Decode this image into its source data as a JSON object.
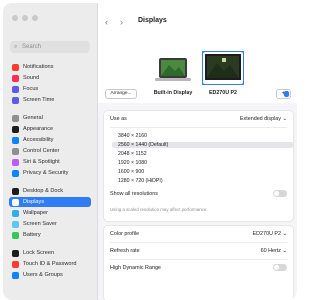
{
  "window": {
    "title": "Displays"
  },
  "sidebar": {
    "search_placeholder": "Search",
    "items": [
      {
        "label": "Notifications",
        "color": "#ff3b30",
        "icon": "bell-icon"
      },
      {
        "label": "Sound",
        "color": "#ff2d55",
        "icon": "speaker-icon"
      },
      {
        "label": "Focus",
        "color": "#5e5ce6",
        "icon": "moon-icon"
      },
      {
        "label": "Screen Time",
        "color": "#5e5ce6",
        "icon": "hourglass-icon"
      },
      {
        "label": "General",
        "color": "#8e8e93",
        "icon": "gear-icon"
      },
      {
        "label": "Appearance",
        "color": "#1d1d1f",
        "icon": "appearance-icon"
      },
      {
        "label": "Accessibility",
        "color": "#0a84ff",
        "icon": "accessibility-icon"
      },
      {
        "label": "Control Center",
        "color": "#8e8e93",
        "icon": "control-center-icon"
      },
      {
        "label": "Siri & Spotlight",
        "color": "#bf5af2",
        "icon": "siri-icon"
      },
      {
        "label": "Privacy & Security",
        "color": "#0a84ff",
        "icon": "hand-icon"
      },
      {
        "label": "Desktop & Dock",
        "color": "#1d1d1f",
        "icon": "dock-icon"
      },
      {
        "label": "Displays",
        "color": "#0a84ff",
        "icon": "display-icon"
      },
      {
        "label": "Wallpaper",
        "color": "#32ade6",
        "icon": "wallpaper-icon"
      },
      {
        "label": "Screen Saver",
        "color": "#5ac8fa",
        "icon": "screensaver-icon"
      },
      {
        "label": "Battery",
        "color": "#34c759",
        "icon": "battery-icon"
      },
      {
        "label": "Lock Screen",
        "color": "#1d1d1f",
        "icon": "lock-icon"
      },
      {
        "label": "Touch ID & Password",
        "color": "#ff3b30",
        "icon": "fingerprint-icon"
      },
      {
        "label": "Users & Groups",
        "color": "#0a84ff",
        "icon": "users-icon"
      }
    ],
    "selected": "Displays"
  },
  "displays": {
    "arrange_label": "Arrange...",
    "builtin_label": "Built-in Display",
    "external_label": "ED270U P2",
    "add_label": "+"
  },
  "settings": {
    "use_as_label": "Use as",
    "use_as_value": "Extended display",
    "resolutions": [
      "3840 × 2160",
      "2560 × 1440 (Default)",
      "2048 × 1152",
      "1920 × 1080",
      "1600 × 900",
      "1280 × 720 (HiDPI)"
    ],
    "selected_resolution": "2560 × 1440 (Default)",
    "show_all_label": "Show all resolutions",
    "scaled_note": "Using a scaled resolution may affect performance.",
    "color_profile_label": "Color profile",
    "color_profile_value": "ED270U P2",
    "refresh_rate_label": "Refresh rate",
    "refresh_rate_value": "60 Hertz",
    "hdr_label": "High Dynamic Range"
  }
}
